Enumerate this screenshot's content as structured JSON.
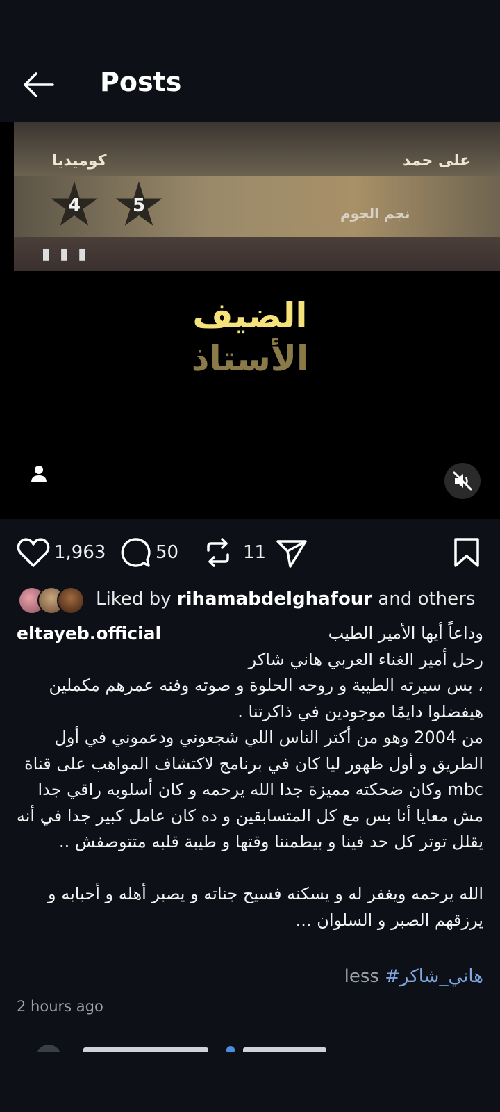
{
  "header": {
    "title": "Posts"
  },
  "media": {
    "banner_left_text": "كوميديا",
    "banner_right_text": "على حمد",
    "banner_logo_text": "نجم الجوم",
    "star_left": "4",
    "star_right": "5",
    "title_primary": "الضيف",
    "title_secondary": "الأستاذ"
  },
  "actions": {
    "likes": "1,963",
    "comments": "50",
    "reposts": "11"
  },
  "liked_by": {
    "prefix": "Liked by ",
    "user": "rihamabdelghafour",
    "suffix": " and others"
  },
  "post": {
    "username": "eltayeb.official",
    "first_line": "وداعاً أيها الأمير الطيب",
    "lines": [
      "رحل  أمير الغناء العربي هاني شاكر",
      "، بس سيرته الطيبة و روحه الحلوة و  صوته وفنه عمرهم مكملين",
      " هيفضلوا  دايمًا موجودين  في ذاكرتنا .",
      "من 2004 وهو من أكتر الناس اللي شجعوني ودعموني في أول",
      "الطريق و أول ظهور ليا كان في برنامج لاكتشاف المواهب على قناة",
      "mbc  وكان ضحكته مميزة جدا الله يرحمه و كان أسلوبه راقي جدا",
      "مش معايا أنا بس مع كل المتسابقين و ده كان عامل كبير جدا في أنه",
      "يقلل توتر كل حد فينا و بيطمننا  وقتها و طيبة قلبه متتوصفش ..",
      "",
      "الله يرحمه ويغفر له و يسكنه فسيح جناته و يصبر أهله و أحبابه و",
      "يرزقهم الصبر و السلوان ..."
    ],
    "hashtag": "#هاني_شاكر",
    "less_label": "less",
    "time": "2 hours ago"
  },
  "colors": {
    "background": "#0d1117",
    "hashtag": "#7ea6e0",
    "muted": "#9aa0a6",
    "title_gold": "#f5e27a"
  },
  "icons": [
    "back-arrow-icon",
    "user-tag-icon",
    "mute-icon",
    "heart-icon",
    "comment-icon",
    "repost-icon",
    "share-icon",
    "bookmark-icon"
  ]
}
